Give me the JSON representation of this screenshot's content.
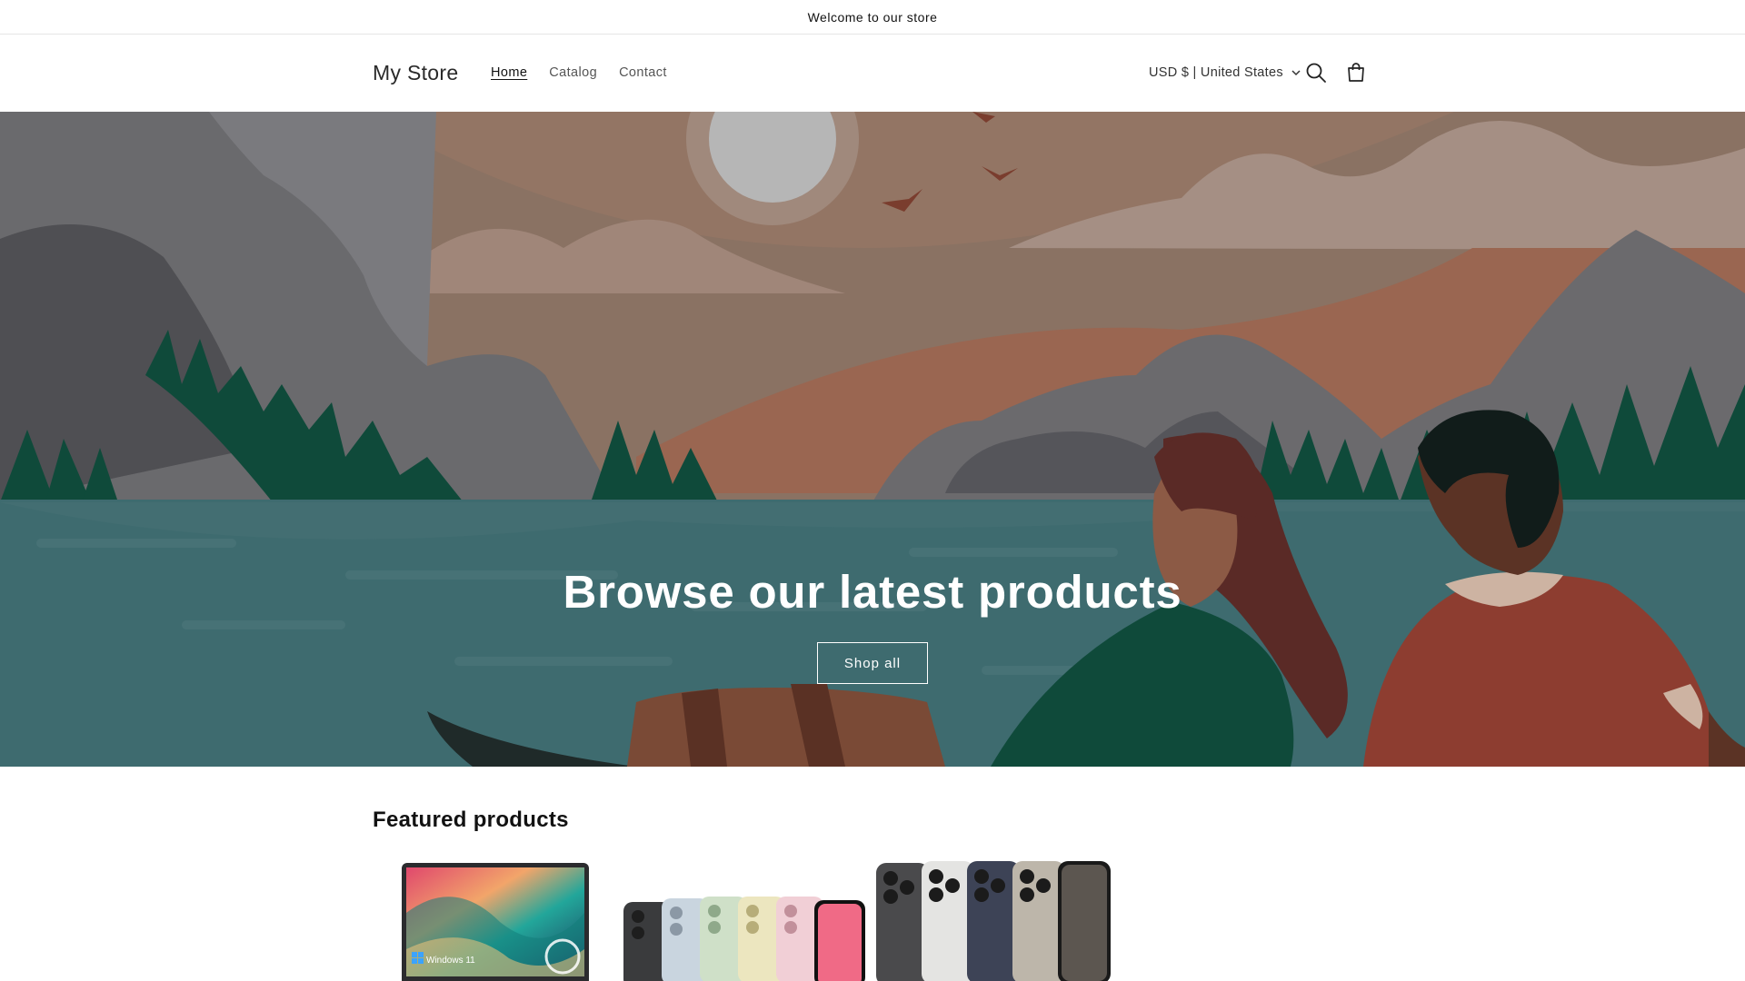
{
  "announcement": {
    "text": "Welcome to our store"
  },
  "header": {
    "logo": "My Store",
    "nav": [
      {
        "label": "Home",
        "active": true
      },
      {
        "label": "Catalog",
        "active": false
      },
      {
        "label": "Contact",
        "active": false
      }
    ],
    "currency": "USD $ | United States",
    "icons": {
      "search": "search-icon",
      "cart": "cart-icon",
      "dropdown": "chevron-down-icon"
    }
  },
  "hero": {
    "title": "Browse our latest products",
    "button_label": "Shop all"
  },
  "featured": {
    "title": "Featured products",
    "products": [
      {
        "image": "laptop-image"
      },
      {
        "image": "colorful-phones-image"
      },
      {
        "image": "titanium-phones-image"
      }
    ],
    "laptop_badge": "Windows 11"
  },
  "colors": {
    "text": "#121212",
    "hero_water": "#3e6b6f",
    "hero_sky": "#8a7263"
  }
}
